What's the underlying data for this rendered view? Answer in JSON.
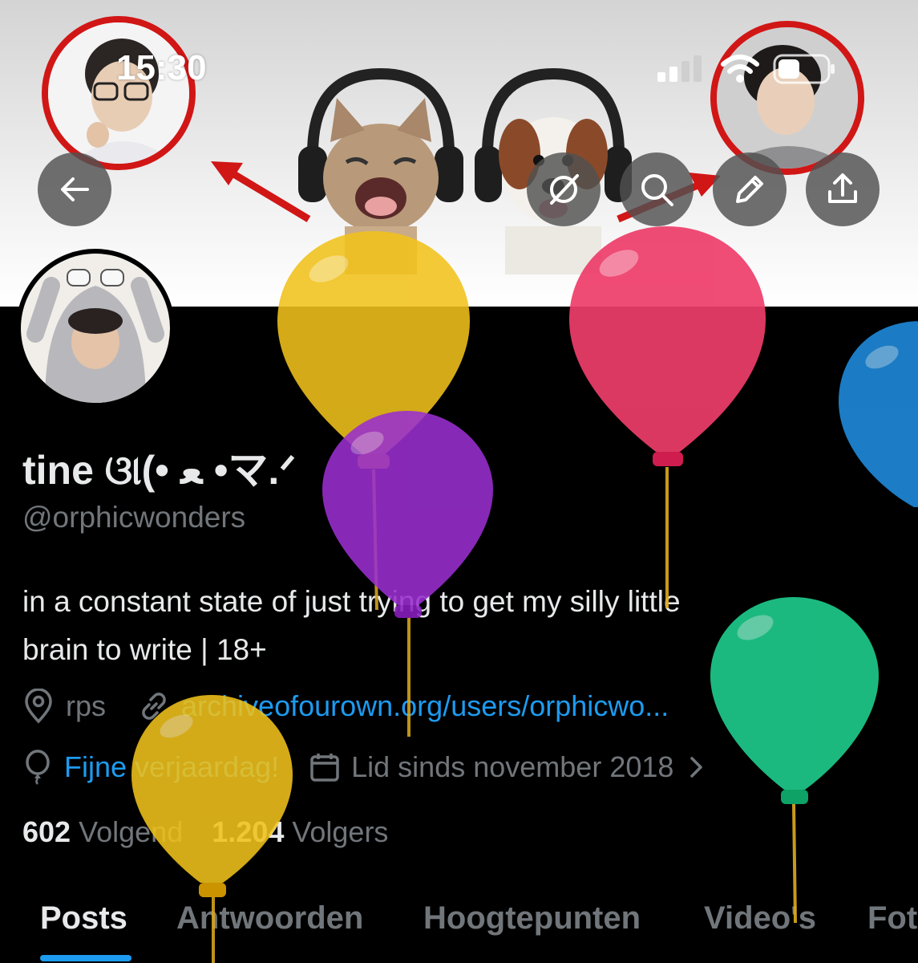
{
  "status_bar": {
    "time": "15:30"
  },
  "profile": {
    "display_name": "tine ଓ୲(• ﻌ •マ.ᐟ",
    "handle": "@orphicwonders",
    "bio_line1": "in a constant state of just trying to get my silly little",
    "bio_line2": "brain to write | 18+",
    "location": "rps",
    "website": "archiveofourown.org/users/orphicwo...",
    "birthday": "Fijne verjaardag!",
    "joined": "Lid sinds november 2018",
    "following_count": "602",
    "following_label": "Volgend",
    "followers_count": "1.204",
    "followers_label": "Volgers"
  },
  "tabs": [
    {
      "label": "Posts"
    },
    {
      "label": "Antwoorden"
    },
    {
      "label": "Hoogtepunten"
    },
    {
      "label": "Video's"
    },
    {
      "label": "Fot"
    }
  ],
  "colors": {
    "accent": "#1d9bf0",
    "highlight": "#d11616",
    "muted": "#71767b"
  },
  "icons": [
    "back-arrow-icon",
    "grok-icon",
    "search-icon",
    "edit-pencil-icon",
    "share-upload-icon",
    "location-pin-icon",
    "link-icon",
    "balloon-icon",
    "calendar-icon",
    "chevron-right-icon",
    "wifi-icon",
    "signal-icon",
    "battery-icon"
  ]
}
